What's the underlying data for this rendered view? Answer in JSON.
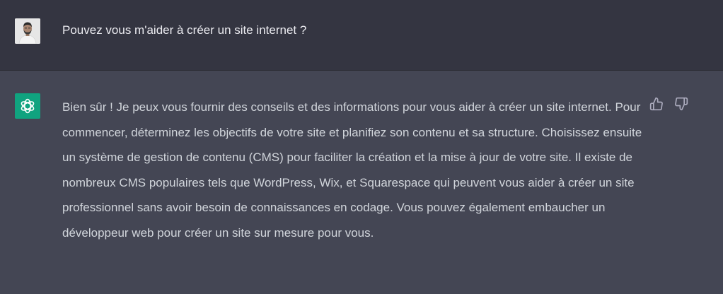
{
  "conversation": {
    "user_message": {
      "avatar": "user-photo-avatar",
      "text": "Pouvez vous m'aider à créer un site internet ?"
    },
    "assistant_message": {
      "avatar": "chatgpt-logo-icon",
      "text": "Bien sûr ! Je peux vous fournir des conseils et des informations pour vous aider à créer un site internet. Pour commencer, déterminez les objectifs de votre site et planifiez son contenu et sa structure. Choisissez ensuite un système de gestion de contenu (CMS) pour faciliter la création et la mise à jour de votre site. Il existe de nombreux CMS populaires tels que WordPress, Wix, et Squarespace qui peuvent vous aider à créer un site professionnel sans avoir besoin de connaissances en codage. Vous pouvez également embaucher un développeur web pour créer un site sur mesure pour vous.",
      "feedback_icons": [
        "thumbs-up-icon",
        "thumbs-down-icon"
      ]
    }
  },
  "colors": {
    "user_background": "#343541",
    "assistant_background": "#444654",
    "bot_avatar": "#10a37f",
    "user_text": "#ececf1",
    "assistant_text": "#d1d5db",
    "icon": "#acacbe"
  }
}
